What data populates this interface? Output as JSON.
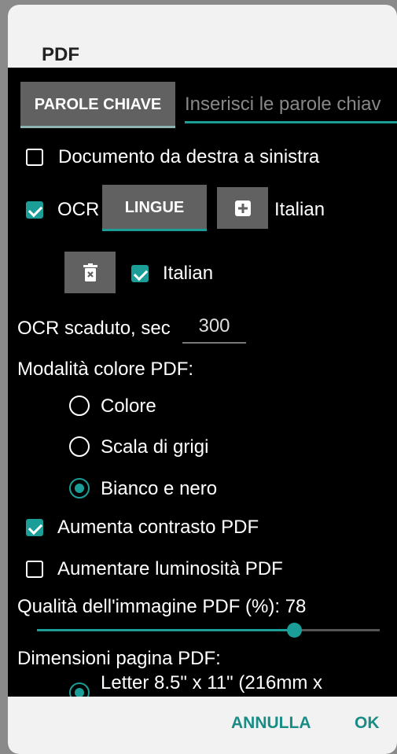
{
  "dialog": {
    "title": "PDF"
  },
  "keywords": {
    "button_label": "PAROLE CHIAVE",
    "input_placeholder": "Inserisci le parole chiav"
  },
  "rtl": {
    "label": "Documento da destra a sinistra",
    "checked": false
  },
  "ocr": {
    "label": "OCR",
    "checked": true,
    "languages_button": "LINGUE",
    "add_language_label": "Italian",
    "selected_language": {
      "label": "Italian",
      "checked": true
    }
  },
  "ocr_timeout": {
    "label": "OCR scaduto, sec",
    "value": "300"
  },
  "color_mode": {
    "label": "Modalità colore PDF:",
    "options": [
      "Colore",
      "Scala di grigi",
      "Bianco e nero"
    ],
    "selected": "Bianco e nero"
  },
  "increase_contrast": {
    "label": "Aumenta contrasto PDF",
    "checked": true
  },
  "increase_brightness": {
    "label": "Aumentare luminosità PDF",
    "checked": false
  },
  "image_quality": {
    "label": "Qualità dell'immagine PDF (%): 78",
    "value": 78
  },
  "page_size": {
    "label": "Dimensioni pagina PDF:",
    "first_option": "Letter 8.5\" x 11\" (216mm x"
  },
  "footer": {
    "cancel_label": "ANNULLA",
    "ok_label": "OK"
  },
  "colors": {
    "accent": "#1a9e97",
    "button_grey": "#616161",
    "background": "#000000",
    "header": "#f2f2f2"
  }
}
